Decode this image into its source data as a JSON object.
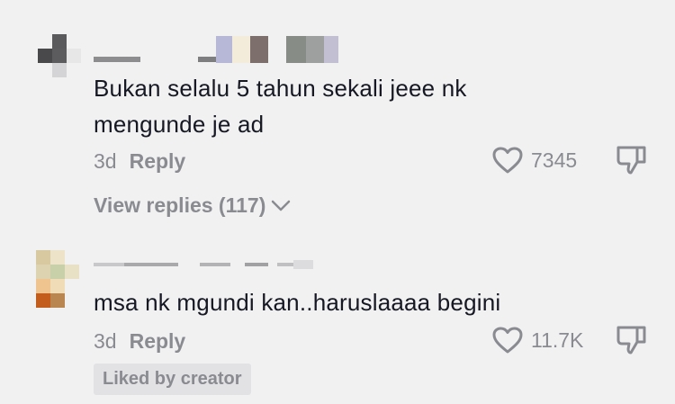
{
  "comments": [
    {
      "text": "Bukan selalu 5 tahun sekali jeee nk mengunde je ad",
      "time": "3d",
      "reply_label": "Reply",
      "likes": "7345",
      "view_replies": "View replies (117)"
    },
    {
      "text": "msa nk mgundi kan..haruslaaaa begini",
      "time": "3d",
      "reply_label": "Reply",
      "likes": "11.7K",
      "badge": "Liked by creator"
    }
  ],
  "icons": {
    "like": "heart-outline-icon",
    "dislike": "thumbs-down-icon",
    "chevron": "chevron-down-icon"
  },
  "colors": {
    "background": "#f1f1f2",
    "text": "#161823",
    "muted": "#8a8b91"
  }
}
